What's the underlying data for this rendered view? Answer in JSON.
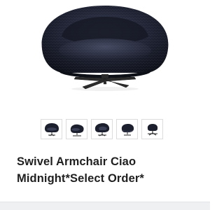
{
  "product": {
    "title_line1": "Swivel Armchair Ciao",
    "title_line2": "Midnight*Select Order*",
    "color_fabric": "#1a1d2b",
    "color_fabric_light": "#2f3447",
    "color_base": "#2a2a2a"
  },
  "gallery": {
    "selected_index": 0,
    "thumbnails": [
      {
        "icon": "armchair-front-thumbnail-icon"
      },
      {
        "icon": "armchair-side-thumbnail-icon"
      },
      {
        "icon": "armchair-angle-thumbnail-icon"
      },
      {
        "icon": "armchair-back-thumbnail-icon"
      },
      {
        "icon": "armchair-base-thumbnail-icon"
      }
    ]
  }
}
